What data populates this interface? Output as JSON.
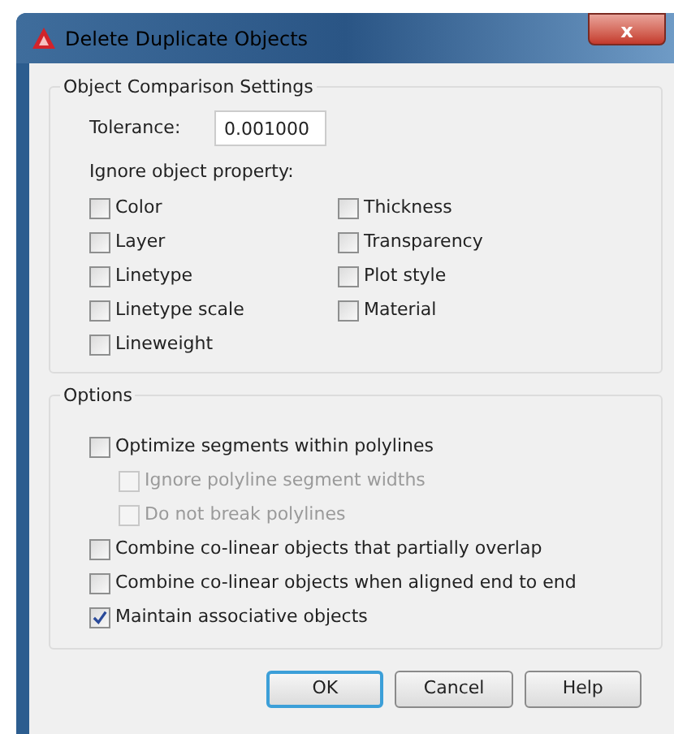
{
  "window": {
    "title": "Delete Duplicate Objects",
    "close": "x"
  },
  "comparison": {
    "legend": "Object Comparison Settings",
    "tolerance_label": "Tolerance:",
    "tolerance_value": "0.001000",
    "ignore_label": "Ignore object property:",
    "properties": [
      {
        "label": "Color",
        "checked": false
      },
      {
        "label": "Layer",
        "checked": false
      },
      {
        "label": "Linetype",
        "checked": false
      },
      {
        "label": "Linetype scale",
        "checked": false
      },
      {
        "label": "Lineweight",
        "checked": false
      },
      {
        "label": "Thickness",
        "checked": false
      },
      {
        "label": "Transparency",
        "checked": false
      },
      {
        "label": "Plot style",
        "checked": false
      },
      {
        "label": "Material",
        "checked": false
      }
    ]
  },
  "options": {
    "legend": "Options",
    "items": [
      {
        "label": "Optimize segments within polylines",
        "checked": false,
        "disabled": false,
        "children": [
          {
            "label": "Ignore polyline segment widths",
            "checked": false,
            "disabled": true
          },
          {
            "label": "Do not break polylines",
            "checked": false,
            "disabled": true
          }
        ]
      },
      {
        "label": "Combine co-linear objects that partially overlap",
        "checked": false,
        "disabled": false
      },
      {
        "label": "Combine co-linear objects when aligned end to end",
        "checked": false,
        "disabled": false
      },
      {
        "label": "Maintain associative objects",
        "checked": true,
        "disabled": false
      }
    ]
  },
  "buttons": [
    {
      "label": "OK",
      "default": true
    },
    {
      "label": "Cancel",
      "default": false
    },
    {
      "label": "Help",
      "default": false
    }
  ]
}
